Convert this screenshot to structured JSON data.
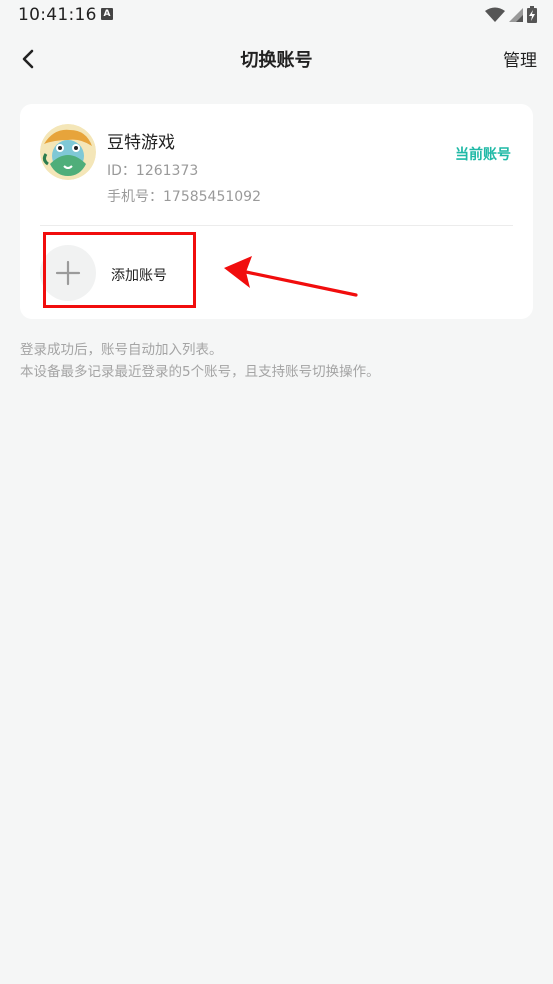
{
  "status_bar": {
    "time": "10:41:16",
    "a_icon": "A",
    "icons": [
      "wifi-icon",
      "signal-icon",
      "battery-charging-icon"
    ]
  },
  "nav": {
    "title": "切换账号",
    "manage_label": "管理",
    "back_icon": "back-chevron-icon"
  },
  "account": {
    "name": "豆特游戏",
    "id_text": "ID：1261373",
    "phone_text": "手机号：17585451092",
    "current_label": "当前账号"
  },
  "add_account": {
    "label": "添加账号",
    "icon": "plus-icon"
  },
  "hints": {
    "line1": "登录成功后，账号自动加入列表。",
    "line2": "本设备最多记录最近登录的5个账号，且支持账号切换操作。"
  },
  "colors": {
    "accent": "#20b9a6",
    "annotation": "#f10d0d",
    "background": "#f5f6f6"
  }
}
